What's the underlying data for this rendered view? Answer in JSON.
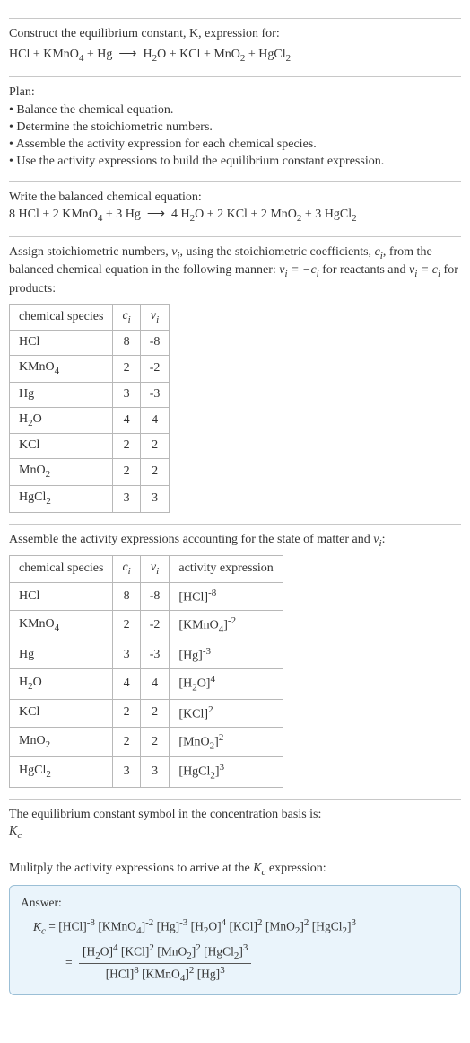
{
  "header": {
    "line1": "Construct the equilibrium constant, K, expression for:"
  },
  "s_plan": {
    "title": "Plan:",
    "items": [
      "Balance the chemical equation.",
      "Determine the stoichiometric numbers.",
      "Assemble the activity expression for each chemical species.",
      "Use the activity expressions to build the equilibrium constant expression."
    ]
  },
  "s_bal": {
    "title": "Write the balanced chemical equation:"
  },
  "s_stoich": {
    "title_a": "Assign stoichiometric numbers, ",
    "title_b": ", using the stoichiometric coefficients, ",
    "title_c": ", from the balanced chemical equation in the following manner: ",
    "title_d": " for reactants and ",
    "title_e": " for products:",
    "table": {
      "headers": [
        "chemical species",
        "cᵢ",
        "νᵢ"
      ],
      "rows": [
        [
          "HCl",
          "8",
          "-8"
        ],
        [
          "KMnO₄",
          "2",
          "-2"
        ],
        [
          "Hg",
          "3",
          "-3"
        ],
        [
          "H₂O",
          "4",
          "4"
        ],
        [
          "KCl",
          "2",
          "2"
        ],
        [
          "MnO₂",
          "2",
          "2"
        ],
        [
          "HgCl₂",
          "3",
          "3"
        ]
      ]
    }
  },
  "s_activity": {
    "title": "Assemble the activity expressions accounting for the state of matter and νᵢ:",
    "headers": [
      "chemical species",
      "cᵢ",
      "νᵢ",
      "activity expression"
    ],
    "rows": [
      {
        "sp": "HCl",
        "c": "8",
        "v": "-8",
        "base": "[HCl]",
        "exp": "-8"
      },
      {
        "sp": "KMnO₄",
        "c": "2",
        "v": "-2",
        "base": "[KMnO₄]",
        "exp": "-2"
      },
      {
        "sp": "Hg",
        "c": "3",
        "v": "-3",
        "base": "[Hg]",
        "exp": "-3"
      },
      {
        "sp": "H₂O",
        "c": "4",
        "v": "4",
        "base": "[H₂O]",
        "exp": "4"
      },
      {
        "sp": "KCl",
        "c": "2",
        "v": "2",
        "base": "[KCl]",
        "exp": "2"
      },
      {
        "sp": "MnO₂",
        "c": "2",
        "v": "2",
        "base": "[MnO₂]",
        "exp": "2"
      },
      {
        "sp": "HgCl₂",
        "c": "3",
        "v": "3",
        "base": "[HgCl₂]",
        "exp": "3"
      }
    ]
  },
  "s_symbol": {
    "line1": "The equilibrium constant symbol in the concentration basis is:",
    "symbol": "K꜀"
  },
  "s_mul": {
    "title": "Mulitply the activity expressions to arrive at the K꜀ expression:"
  },
  "answer": {
    "label": "Answer:"
  },
  "chart_data": {
    "type": "table",
    "title": "Stoichiometric coefficients and numbers",
    "columns": [
      "chemical species",
      "c_i",
      "ν_i"
    ],
    "rows": [
      [
        "HCl",
        8,
        -8
      ],
      [
        "KMnO4",
        2,
        -2
      ],
      [
        "Hg",
        3,
        -3
      ],
      [
        "H2O",
        4,
        4
      ],
      [
        "KCl",
        2,
        2
      ],
      [
        "MnO2",
        2,
        2
      ],
      [
        "HgCl2",
        3,
        3
      ]
    ],
    "balanced_equation": {
      "reactants": [
        {
          "sp": "HCl",
          "coef": 8
        },
        {
          "sp": "KMnO4",
          "coef": 2
        },
        {
          "sp": "Hg",
          "coef": 3
        }
      ],
      "products": [
        {
          "sp": "H2O",
          "coef": 4
        },
        {
          "sp": "KCl",
          "coef": 2
        },
        {
          "sp": "MnO2",
          "coef": 2
        },
        {
          "sp": "HgCl2",
          "coef": 3
        }
      ]
    },
    "Kc_expression": "([H2O]^4 [KCl]^2 [MnO2]^2 [HgCl2]^3) / ([HCl]^8 [KMnO4]^2 [Hg]^3)"
  }
}
